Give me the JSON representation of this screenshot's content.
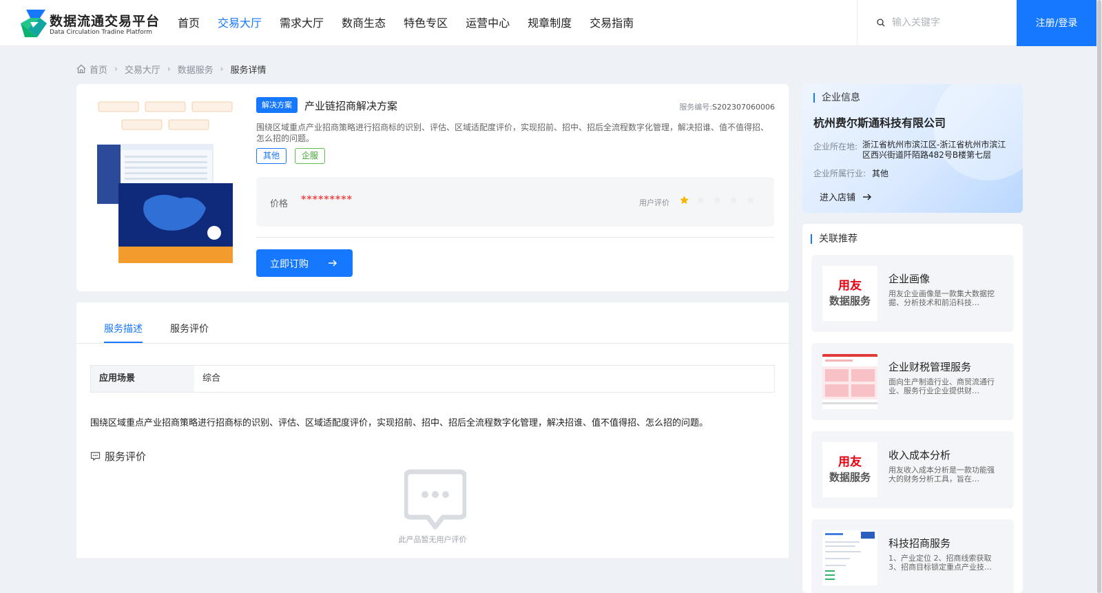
{
  "header": {
    "logo_title": "数据流通交易平台",
    "logo_sub": "Data Circulation Tradine Platform",
    "nav": [
      "首页",
      "交易大厅",
      "需求大厅",
      "数商生态",
      "特色专区",
      "运营中心",
      "规章制度",
      "交易指南"
    ],
    "nav_active": "交易大厅",
    "search_placeholder": "输入关键字",
    "login_label": "注册/登录",
    "accent": "#1677ff"
  },
  "breadcrumb": [
    "首页",
    "交易大厅",
    "数据服务",
    "服务详情"
  ],
  "product": {
    "type_tag": "解决方案",
    "title": "产业链招商解决方案",
    "code_label": "服务编号:",
    "code": "S202307060006",
    "description": "围绕区域重点产业招商策略进行招商标的识别、评估、区域适配度评价，实现招前、招中、招后全流程数字化管理，解决招谁、值不值得招、怎么招的问题。",
    "chips": [
      "其他",
      "企服"
    ],
    "price_label": "价格",
    "price_value": "*********",
    "rating_label": "用户评价",
    "rating": 1,
    "rating_max": 5,
    "buy_label": "立即订购"
  },
  "details": {
    "tabs": [
      "服务描述",
      "服务评价"
    ],
    "active_tab": "服务描述",
    "scene_label": "应用场景",
    "scene_value": "综合",
    "long_description": "围绕区域重点产业招商策略进行招商标的识别、评估、区域适配度评价，实现招前、招中、招后全流程数字化管理，解决招谁、值不值得招、怎么招的问题。",
    "review_heading": "服务评价",
    "empty_text": "此产品暂无用户评价"
  },
  "company": {
    "section_title": "企业信息",
    "name": "杭州费尔斯通科技有限公司",
    "location_label": "企业所在地:",
    "location": "浙江省杭州市滨江区-浙江省杭州市滨江区西兴街道阡陌路482号B楼第七层",
    "industry_label": "企业所属行业:",
    "industry": "其他",
    "shop_label": "进入店铺"
  },
  "related": {
    "section_title": "关联推荐",
    "items": [
      {
        "title": "企业画像",
        "desc": "用友企业画像是一款集大数据挖掘、分析技术和前沿科技…",
        "image": "yonyou-logo"
      },
      {
        "title": "企业财税管理服务",
        "desc": "面向生产制造行业、商贸流通行业、服务行业企业提供财…",
        "image": "tax-screenshot"
      },
      {
        "title": "收入成本分析",
        "desc": "用友收入成本分析是一款功能强大的财务分析工具，旨在…",
        "image": "yonyou-logo"
      },
      {
        "title": "科技招商服务",
        "desc": "1、产业定位 2、招商线索获取 3、招商目标锁定重点产业技…",
        "image": "report-screenshot"
      }
    ],
    "logo_line1": "用友",
    "logo_line2": "数据服务"
  }
}
